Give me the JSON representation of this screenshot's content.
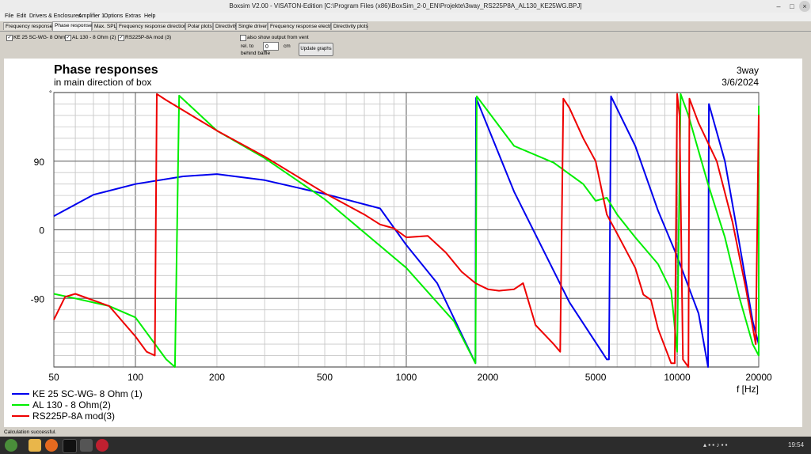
{
  "window": {
    "title": "Boxsim V2.00 - VISATON-Edition [C:\\Program Files (x86)\\BoxSim_2-0_EN\\Projekte\\3way_RS225P8A_AL130_KE25WG.BPJ]",
    "minimize": "–",
    "maximize": "□",
    "close": "×"
  },
  "menu": {
    "items": [
      "File",
      "Edit",
      "Drivers & Enclosures",
      "Amplifier 1",
      "Options",
      "Extras",
      "Help"
    ]
  },
  "tabs": [
    "Frequency response",
    "Phase response",
    "Max. SPL",
    "Frequency response directions",
    "Polar plots",
    "Directivity",
    "Single driver",
    "Frequency response electr.",
    "Directivity plots"
  ],
  "controls": {
    "driver1": "KE 25 SC-WG- 8 Ohm",
    "driver2": "AL 130 - 8 Ohm (2)",
    "driver3": "RS225P-8A mod (3)",
    "show_vent": "also show output from vent",
    "rel_to": "rel. to",
    "behind_baffle": "behind baffle",
    "offset_value": "0",
    "offset_unit": "cm",
    "update_button": "Update graphs"
  },
  "plot": {
    "title": "Phase responses",
    "subtitle": "in main direction of box",
    "corner_name": "3way",
    "corner_date": "3/6/2024",
    "y_top_marker": "°",
    "x_unit_label": "f [Hz]"
  },
  "chart_data": {
    "type": "line",
    "title": "Phase responses",
    "subtitle": "in main direction of box",
    "xlabel": "f [Hz]",
    "ylabel": "",
    "xscale": "log",
    "xlim": [
      50,
      20000
    ],
    "ylim": [
      -180,
      180
    ],
    "x_ticks": [
      50,
      100,
      200,
      500,
      1000,
      2000,
      5000,
      10000,
      20000
    ],
    "x_tick_labels": [
      "50",
      "100",
      "200",
      "500",
      "1000",
      "2000",
      "5000",
      "10000",
      "20000"
    ],
    "y_ticks": [
      90,
      0,
      -90
    ],
    "y_tick_labels": [
      "90",
      "0",
      "-90"
    ],
    "grid": true,
    "legend_position": "bottom-left",
    "series": [
      {
        "name": "KE 25 SC-WG- 8 Ohm   (1)",
        "color": "#0000ee",
        "points": [
          [
            50,
            18
          ],
          [
            70,
            46
          ],
          [
            100,
            60
          ],
          [
            150,
            70
          ],
          [
            200,
            73
          ],
          [
            300,
            65
          ],
          [
            500,
            47
          ],
          [
            800,
            28
          ],
          [
            1000,
            -20
          ],
          [
            1300,
            -70
          ],
          [
            1800,
            -175
          ],
          [
            1810,
            173
          ],
          [
            2500,
            50
          ],
          [
            4000,
            -95
          ],
          [
            5500,
            -170
          ],
          [
            5600,
            -170
          ],
          [
            5700,
            175
          ],
          [
            7000,
            110
          ],
          [
            8500,
            25
          ],
          [
            10000,
            -35
          ],
          [
            12000,
            -110
          ],
          [
            13000,
            -183
          ],
          [
            13100,
            165
          ],
          [
            15000,
            90
          ],
          [
            17000,
            -20
          ],
          [
            19000,
            -120
          ],
          [
            20000,
            -150
          ]
        ]
      },
      {
        "name": "AL 130 - 8 Ohm(2)",
        "color": "#00ee00",
        "points": [
          [
            50,
            -84
          ],
          [
            60,
            -90
          ],
          [
            80,
            -100
          ],
          [
            100,
            -115
          ],
          [
            130,
            -170
          ],
          [
            140,
            -180
          ],
          [
            145,
            176
          ],
          [
            200,
            130
          ],
          [
            300,
            94
          ],
          [
            500,
            40
          ],
          [
            1000,
            -50
          ],
          [
            1500,
            -120
          ],
          [
            1800,
            -175
          ],
          [
            1820,
            175
          ],
          [
            2500,
            110
          ],
          [
            3500,
            88
          ],
          [
            4500,
            60
          ],
          [
            5000,
            38
          ],
          [
            5500,
            42
          ],
          [
            6000,
            20
          ],
          [
            7000,
            -10
          ],
          [
            8500,
            -45
          ],
          [
            9500,
            -80
          ],
          [
            10000,
            -160
          ],
          [
            10300,
            178
          ],
          [
            11000,
            150
          ],
          [
            13000,
            60
          ],
          [
            15000,
            -10
          ],
          [
            17000,
            -90
          ],
          [
            19000,
            -150
          ],
          [
            20000,
            -165
          ],
          [
            20050,
            162
          ],
          [
            21000,
            130
          ]
        ]
      },
      {
        "name": "RS225P-8A mod(3)",
        "color": "#ee0000",
        "points": [
          [
            50,
            -118
          ],
          [
            55,
            -88
          ],
          [
            60,
            -84
          ],
          [
            80,
            -100
          ],
          [
            100,
            -140
          ],
          [
            110,
            -160
          ],
          [
            118,
            -165
          ],
          [
            120,
            178
          ],
          [
            130,
            170
          ],
          [
            200,
            130
          ],
          [
            300,
            96
          ],
          [
            500,
            48
          ],
          [
            700,
            20
          ],
          [
            800,
            7
          ],
          [
            900,
            2
          ],
          [
            1000,
            -10
          ],
          [
            1200,
            -8
          ],
          [
            1400,
            -30
          ],
          [
            1600,
            -55
          ],
          [
            1800,
            -70
          ],
          [
            2000,
            -78
          ],
          [
            2200,
            -80
          ],
          [
            2500,
            -78
          ],
          [
            2700,
            -70
          ],
          [
            3000,
            -125
          ],
          [
            3500,
            -150
          ],
          [
            3700,
            -160
          ],
          [
            3800,
            172
          ],
          [
            4000,
            160
          ],
          [
            4500,
            120
          ],
          [
            5000,
            90
          ],
          [
            5500,
            20
          ],
          [
            6000,
            -5
          ],
          [
            7000,
            -50
          ],
          [
            7500,
            -85
          ],
          [
            8000,
            -92
          ],
          [
            8500,
            -130
          ],
          [
            9500,
            -175
          ],
          [
            9800,
            -175
          ],
          [
            10000,
            178
          ],
          [
            10200,
            150
          ],
          [
            10500,
            -170
          ],
          [
            11000,
            -183
          ],
          [
            11100,
            172
          ],
          [
            12000,
            140
          ],
          [
            14000,
            90
          ],
          [
            16000,
            10
          ],
          [
            18000,
            -80
          ],
          [
            19500,
            -150
          ],
          [
            20000,
            150
          ],
          [
            20500,
            120
          ]
        ]
      }
    ]
  },
  "status": {
    "text": "Calculation successful."
  },
  "taskbar": {
    "time": "19:54"
  }
}
